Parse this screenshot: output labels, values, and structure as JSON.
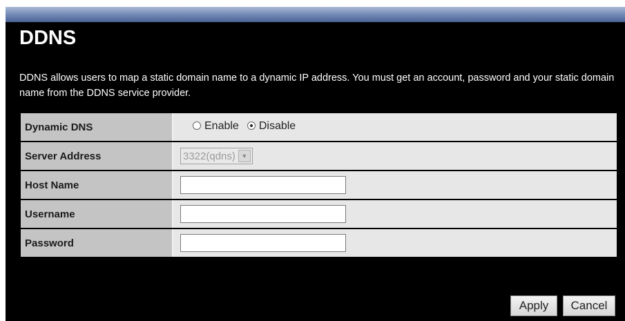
{
  "page": {
    "title": "DDNS",
    "description": "DDNS allows users to map a static domain name to a dynamic IP address. You must get an account, password and your static domain name from the DDNS service provider."
  },
  "form": {
    "dynamic_dns": {
      "label": "Dynamic DNS",
      "options": [
        "Enable",
        "Disable"
      ],
      "selected": "Disable"
    },
    "server_address": {
      "label": "Server Address",
      "value": "3322(qdns)"
    },
    "host_name": {
      "label": "Host Name",
      "value": ""
    },
    "username": {
      "label": "Username",
      "value": ""
    },
    "password": {
      "label": "Password",
      "value": ""
    }
  },
  "buttons": {
    "apply": "Apply",
    "cancel": "Cancel"
  },
  "colors": {
    "background": "#000000",
    "label_cell": "#c4c4c4",
    "value_cell": "#e7e7e7",
    "title_text": "#ffffff"
  }
}
